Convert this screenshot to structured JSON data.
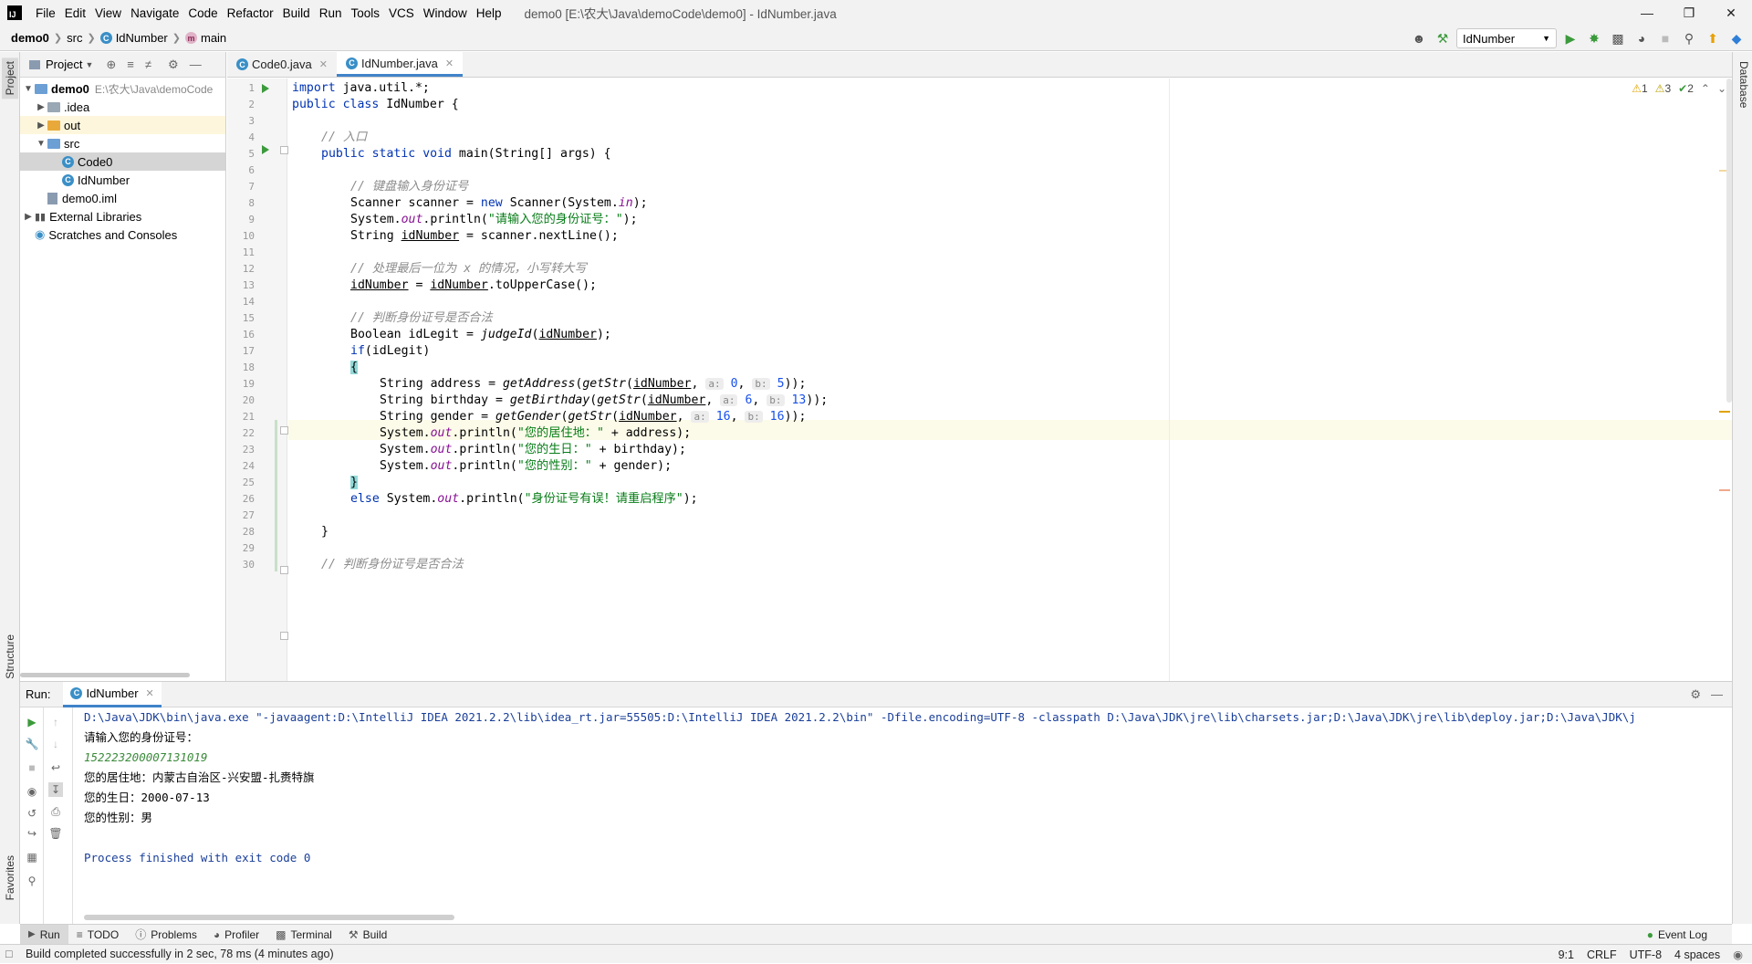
{
  "menubar": {
    "logo": "IJ",
    "items": [
      "File",
      "Edit",
      "View",
      "Navigate",
      "Code",
      "Refactor",
      "Build",
      "Run",
      "Tools",
      "VCS",
      "Window",
      "Help"
    ],
    "title": "demo0 [E:\\农大\\Java\\demoCode\\demo0] - IdNumber.java"
  },
  "breadcrumbs": {
    "project": "demo0",
    "folder": "src",
    "class": "IdNumber",
    "method": "main"
  },
  "run_config": "IdNumber",
  "left_stripe": {
    "project": "Project",
    "structure": "Structure",
    "favorites": "Favorites"
  },
  "right_stripe": {
    "database": "Database"
  },
  "project_panel": {
    "title": "Project",
    "tree": [
      {
        "label": "demo0",
        "extra": "E:\\农大\\Java\\demoCode"
      },
      {
        "label": ".idea"
      },
      {
        "label": "out"
      },
      {
        "label": "src"
      },
      {
        "label": "Code0"
      },
      {
        "label": "IdNumber"
      },
      {
        "label": "demo0.iml"
      },
      {
        "label": "External Libraries"
      },
      {
        "label": "Scratches and Consoles"
      }
    ]
  },
  "editor": {
    "tabs": [
      {
        "label": "Code0.java"
      },
      {
        "label": "IdNumber.java"
      }
    ],
    "inspections": {
      "warnings": "1",
      "weak": "3",
      "ok": "2"
    },
    "line_numbers": [
      "1",
      "2",
      "3",
      "4",
      "5",
      "6",
      "7",
      "8",
      "9",
      "10",
      "11",
      "12",
      "13",
      "14",
      "15",
      "16",
      "17",
      "18",
      "19",
      "20",
      "21",
      "22",
      "23",
      "24",
      "25",
      "26",
      "27",
      "28",
      "29",
      "30"
    ],
    "code": {
      "l1_kw": "import",
      "l1_rest": " java.util.*;",
      "l2_kw1": "public",
      "l2_kw2": "class",
      "l2_rest": " IdNumber {",
      "l4": "// 入口",
      "l5_kw1": "public",
      "l5_kw2": "static",
      "l5_kw3": "void",
      "l5_rest": " main(String[] args) {",
      "l7": "// 键盘输入身份证号",
      "l8_a": "Scanner scanner = ",
      "l8_kw": "new",
      "l8_b": " Scanner(System.",
      "l8_field": "in",
      "l8_c": ");",
      "l9_a": "System.",
      "l9_field": "out",
      "l9_b": ".println(",
      "l9_str": "\"请输入您的身份证号：\"",
      "l9_c": ");",
      "l10_a": "String ",
      "l10_var": "idNumber",
      "l10_b": " = scanner.nextLine();",
      "l12": "// 处理最后一位为 x 的情况，小写转大写",
      "l13_var1": "idNumber",
      "l13_a": " = ",
      "l13_var2": "idNumber",
      "l13_b": ".toUpperCase();",
      "l15": "// 判断身份证号是否合法",
      "l16_a": "Boolean idLegit = ",
      "l16_fn": "judgeId",
      "l16_b": "(",
      "l16_var": "idNumber",
      "l16_c": ");",
      "l17_kw": "if",
      "l17_rest": "(idLegit)",
      "l18": "{",
      "l19_a": "String address = ",
      "l19_fn1": "getAddress",
      "l19_fn2": "getStr",
      "l19_var": "idNumber",
      "l19_h1": "a:",
      "l19_n1": "0",
      "l19_h2": "b:",
      "l19_n2": "5",
      "l20_a": "String birthday = ",
      "l20_fn1": "getBirthday",
      "l20_fn2": "getStr",
      "l20_var": "idNumber",
      "l20_h1": "a:",
      "l20_n1": "6",
      "l20_h2": "b:",
      "l20_n2": "13",
      "l21_a": "String gender = ",
      "l21_fn1": "getGender",
      "l21_fn2": "getStr",
      "l21_var": "idNumber",
      "l21_h1": "a:",
      "l21_n1": "16",
      "l21_h2": "b:",
      "l21_n2": "16",
      "l22_str": "\"您的居住地：\"",
      "l22_rest": " + address);",
      "l23_str": "\"您的生日：\"",
      "l23_rest": " + birthday);",
      "l24_str": "\"您的性别：\"",
      "l24_rest": " + gender);",
      "l25": "}",
      "l26_kw": "else",
      "l26_a": " System.",
      "l26_field": "out",
      "l26_b": ".println(",
      "l26_str": "\"身份证号有误！请重启程序\"",
      "l26_c": ");",
      "l28": "}",
      "l30": "// 判断身份证号是否合法"
    }
  },
  "run_panel": {
    "label": "Run:",
    "tab": "IdNumber",
    "console": {
      "cmd": "D:\\Java\\JDK\\bin\\java.exe \"-javaagent:D:\\IntelliJ IDEA 2021.2.2\\lib\\idea_rt.jar=55505:D:\\IntelliJ IDEA 2021.2.2\\bin\" -Dfile.encoding=UTF-8 -classpath D:\\Java\\JDK\\jre\\lib\\charsets.jar;D:\\Java\\JDK\\jre\\lib\\deploy.jar;D:\\Java\\JDK\\j",
      "prompt": "请输入您的身份证号：",
      "input": "152223200007131019",
      "address": "您的居住地：内蒙古自治区-兴安盟-扎赉特旗",
      "birthday": "您的生日：2000-07-13",
      "gender": "您的性别：男",
      "exit": "Process finished with exit code 0"
    }
  },
  "bottom_tabs": [
    {
      "label": "Run"
    },
    {
      "label": "TODO"
    },
    {
      "label": "Problems"
    },
    {
      "label": "Profiler"
    },
    {
      "label": "Terminal"
    },
    {
      "label": "Build"
    }
  ],
  "event_log": "Event Log",
  "status": {
    "message": "Build completed successfully in 2 sec, 78 ms (4 minutes ago)",
    "position": "9:1",
    "line_sep": "CRLF",
    "encoding": "UTF-8",
    "indent": "4 spaces"
  },
  "colors": {
    "accent": "#4083c9",
    "keyword": "#0033b3",
    "string": "#067d17",
    "comment": "#8c8c8c",
    "field": "#871094"
  }
}
